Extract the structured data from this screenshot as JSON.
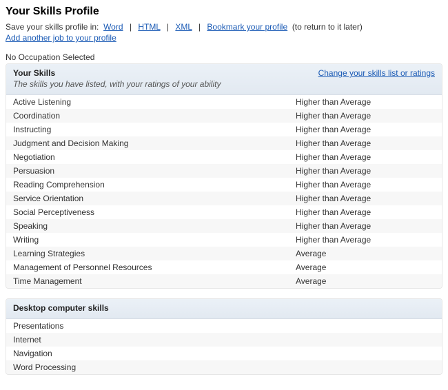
{
  "page_title": "Your Skills Profile",
  "save_text": "Save your skills profile in:",
  "save_links": {
    "word": "Word",
    "html": "HTML",
    "xml": "XML",
    "bookmark": "Bookmark your profile"
  },
  "save_suffix": "(to return to it later)",
  "add_job_link": "Add another job to your profile",
  "no_occupation": "No Occupation Selected",
  "skills_panel": {
    "title": "Your Skills",
    "subtitle": "The skills you have listed, with your ratings of your ability",
    "change_link": "Change your skills list or ratings",
    "rows": [
      {
        "skill": "Active Listening",
        "rating": "Higher than Average"
      },
      {
        "skill": "Coordination",
        "rating": "Higher than Average"
      },
      {
        "skill": "Instructing",
        "rating": "Higher than Average"
      },
      {
        "skill": "Judgment and Decision Making",
        "rating": "Higher than Average"
      },
      {
        "skill": "Negotiation",
        "rating": "Higher than Average"
      },
      {
        "skill": "Persuasion",
        "rating": "Higher than Average"
      },
      {
        "skill": "Reading Comprehension",
        "rating": "Higher than Average"
      },
      {
        "skill": "Service Orientation",
        "rating": "Higher than Average"
      },
      {
        "skill": "Social Perceptiveness",
        "rating": "Higher than Average"
      },
      {
        "skill": "Speaking",
        "rating": "Higher than Average"
      },
      {
        "skill": "Writing",
        "rating": "Higher than Average"
      },
      {
        "skill": "Learning Strategies",
        "rating": "Average"
      },
      {
        "skill": "Management of Personnel Resources",
        "rating": "Average"
      },
      {
        "skill": "Time Management",
        "rating": "Average"
      }
    ]
  },
  "desktop_panel": {
    "title": "Desktop computer skills",
    "rows": [
      {
        "skill": "Presentations"
      },
      {
        "skill": "Internet"
      },
      {
        "skill": "Navigation"
      },
      {
        "skill": "Word Processing"
      }
    ]
  }
}
